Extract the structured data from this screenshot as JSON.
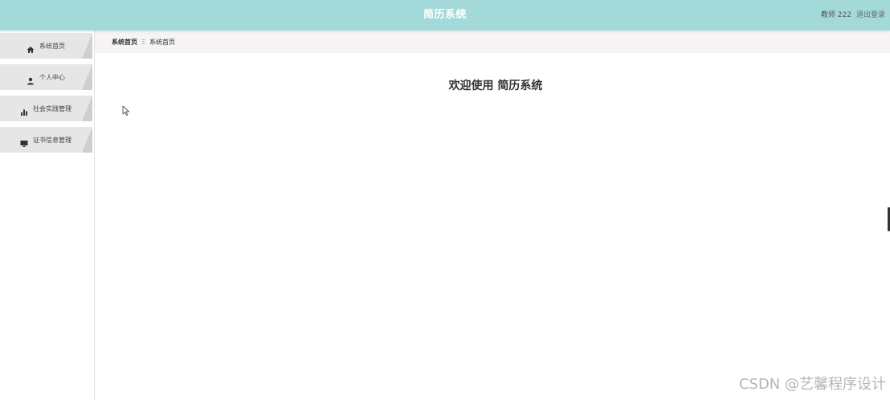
{
  "header": {
    "title": "简历系统",
    "user": "教师 222",
    "logout": "退出登录"
  },
  "sidebar": {
    "items": [
      {
        "label": "系统首页",
        "icon": "home-icon"
      },
      {
        "label": "个人中心",
        "icon": "user-icon"
      },
      {
        "label": "社会实践管理",
        "icon": "bar-chart-icon"
      },
      {
        "label": "证书信息管理",
        "icon": "monitor-icon"
      }
    ]
  },
  "breadcrumb": {
    "first": "系统首页",
    "separator": "Ξ",
    "current": "系统首页"
  },
  "main": {
    "welcome": "欢迎使用 简历系统"
  },
  "watermark": "CSDN @艺馨程序设计",
  "colors": {
    "header_bg": "#a3dad9",
    "menu_bg": "#e6e6e6",
    "breadcrumb_bg": "#f6f4f4"
  }
}
